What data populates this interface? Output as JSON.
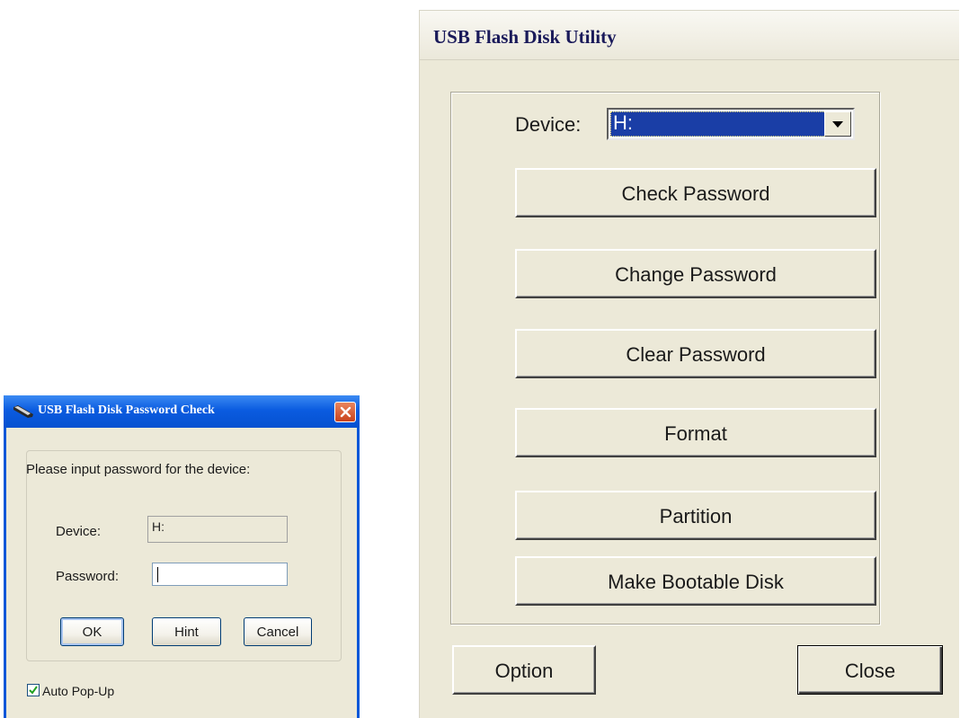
{
  "password_dialog": {
    "title": "USB Flash Disk Password Check",
    "prompt": "Please input password for the device:",
    "device_label": "Device:",
    "device_value": "H:",
    "password_label": "Password:",
    "password_value": "",
    "buttons": {
      "ok": "OK",
      "hint": "Hint",
      "cancel": "Cancel"
    },
    "auto_popup_label": "Auto Pop-Up",
    "auto_popup_checked": true,
    "icons": {
      "title": "usb-drive-icon",
      "close": "close-icon",
      "check": "checkmark-icon"
    }
  },
  "utility_window": {
    "title": "USB Flash Disk Utility",
    "device_label": "Device:",
    "device_selected": "H:",
    "buttons": {
      "check_password": "Check Password",
      "change_password": "Change Password",
      "clear_password": "Clear Password",
      "format": "Format",
      "partition": "Partition",
      "make_bootable": "Make Bootable Disk",
      "option": "Option",
      "close": "Close"
    },
    "icons": {
      "dropdown": "dropdown-arrow-icon"
    }
  },
  "colors": {
    "xp_blue": "#0a57d8",
    "dialog_bg": "#ece9d8",
    "selection": "#1a3ea6",
    "close_red": "#c9421c"
  }
}
